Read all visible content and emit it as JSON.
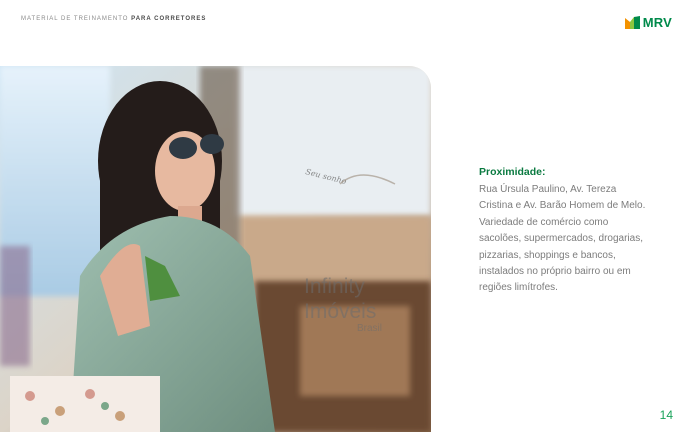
{
  "header": {
    "prefix": "MATERIAL DE TREINAMENTO",
    "bold": "PARA CORRETORES"
  },
  "logo": {
    "text": "MRV",
    "icon": "mrv-logo-icon"
  },
  "photo": {
    "description_icon": "woman-shopping-photo",
    "watermark": {
      "tagline": "Seu sonho",
      "line1": "Infinity",
      "line2": "Imóveis",
      "line3": "Brasil"
    }
  },
  "content": {
    "title": "Proximidade:",
    "body": "Rua Úrsula Paulino, Av. Tereza Cristina e Av. Barão Homem de Melo. Variedade de comércio como sacolões, supermercados, drogarias, pizzarias, shoppings e bancos, instalados no próprio bairro ou em regiões limítrofes."
  },
  "page_number": "14",
  "colors": {
    "brand_green": "#008a4b",
    "title_green": "#0a7a40",
    "body_gray": "#7c7c7c",
    "logo_orange": "#f39200",
    "logo_light_green": "#8cc63f"
  }
}
